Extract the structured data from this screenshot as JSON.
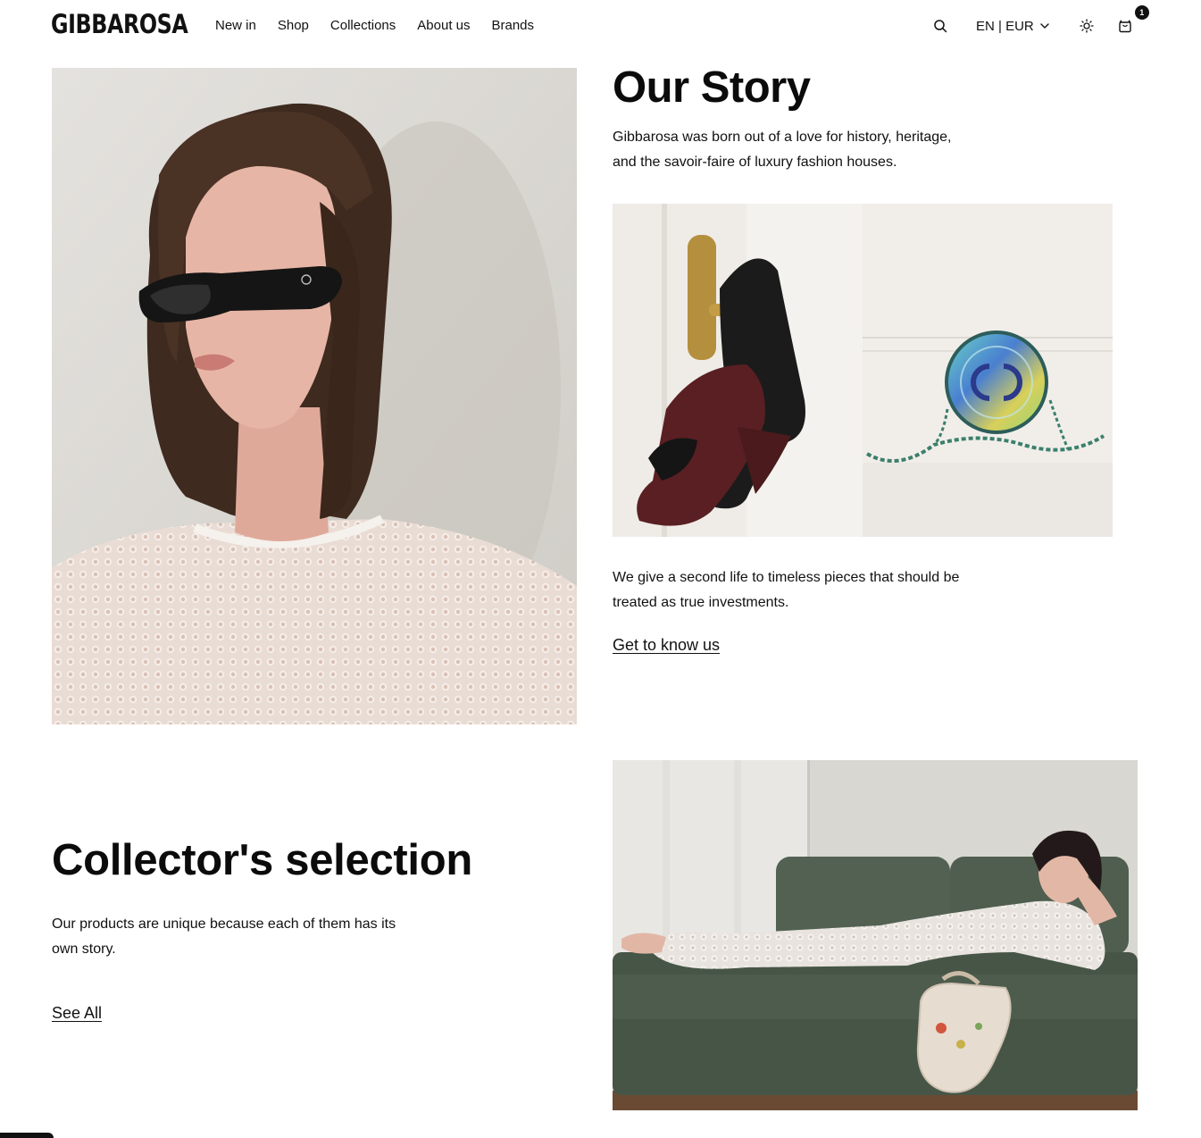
{
  "brand": {
    "logo": "GIBBAROSA"
  },
  "nav": {
    "items": [
      {
        "label": "New in"
      },
      {
        "label": "Shop"
      },
      {
        "label": "Collections"
      },
      {
        "label": "About us"
      },
      {
        "label": "Brands"
      }
    ]
  },
  "header_utils": {
    "search_icon": "search-icon",
    "locale": "EN | EUR",
    "locale_icon": "chevron-down-icon",
    "theme_icon": "sun-icon",
    "cart_icon": "shopping-bag-icon",
    "cart_count": "1"
  },
  "story": {
    "title": "Our Story",
    "intro": "Gibbarosa was born out of a love for history, heritage, and the savoir-faire of luxury fashion houses.",
    "body": "We give a second life to timeless pieces that should be treated as true investments.",
    "link": "Get to know us"
  },
  "collectors": {
    "title": "Collector's selection",
    "body": "Our products are unique because each of them has its own story.",
    "link": "See All"
  },
  "colors": {
    "text": "#111111",
    "background": "#ffffff",
    "sofa": "#4a5a4a",
    "shoe": "#5a1f22"
  }
}
